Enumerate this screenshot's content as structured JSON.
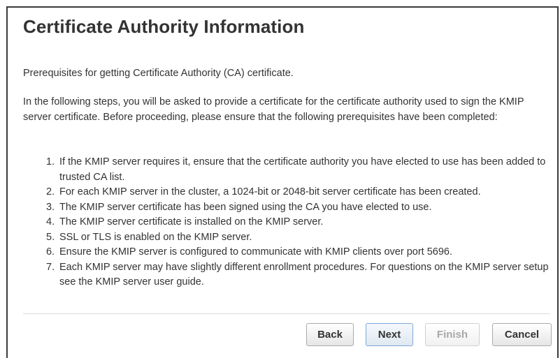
{
  "dialog": {
    "title": "Certificate Authority Information",
    "prereq_title": "Prerequisites for getting Certificate Authority (CA) certificate.",
    "intro": "In the following steps, you will be asked to provide a certificate for the certificate authority used to sign the KMIP server certificate. Before proceeding, please ensure that the following prerequisites have been completed:",
    "steps": [
      {
        "num": "1.",
        "text": "If the KMIP server requires it, ensure that the certificate authority you have elected to use has been added to trusted CA list."
      },
      {
        "num": "2.",
        "text": "For each KMIP server in the cluster, a 1024-bit or 2048-bit server certificate has been created."
      },
      {
        "num": "3.",
        "text": "The KMIP server certificate has been signed using the CA you have elected to use."
      },
      {
        "num": "4.",
        "text": "The KMIP server certificate is installed on the KMIP server."
      },
      {
        "num": "5.",
        "text": "SSL or TLS is enabled on the KMIP server."
      },
      {
        "num": "6.",
        "text": "Ensure the KMIP server is configured to communicate with KMIP clients over port 5696."
      },
      {
        "num": "7.",
        "text": "Each KMIP server may have slightly different enrollment procedures. For questions on the KMIP server setup see the KMIP server user guide."
      }
    ]
  },
  "buttons": {
    "back": "Back",
    "next": "Next",
    "finish": "Finish",
    "cancel": "Cancel"
  }
}
